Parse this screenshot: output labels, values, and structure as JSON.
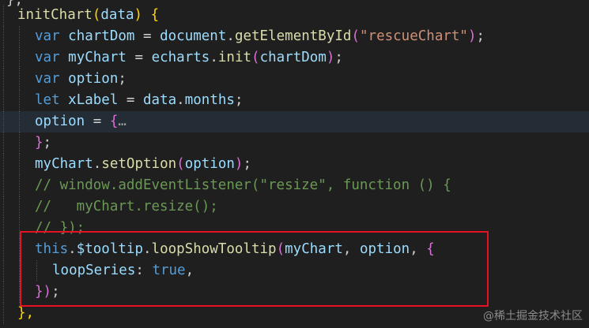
{
  "code": {
    "line0": {
      "text": "};"
    },
    "line1": {
      "name": "initChart",
      "open": "(",
      "param": "data",
      "close": ")",
      "brace": "{"
    },
    "line2": {
      "kw": "var",
      "name": "chartDom",
      "op": "=",
      "obj": "document",
      "method": "getElementById",
      "open": "(",
      "arg": "\"rescueChart\"",
      "close": ")",
      "end": ";"
    },
    "line3": {
      "kw": "var",
      "name": "myChart",
      "op": "=",
      "obj": "echarts",
      "method": "init",
      "open": "(",
      "arg": "chartDom",
      "close": ")",
      "end": ";"
    },
    "line4": {
      "kw": "var",
      "name": "option",
      "end": ";"
    },
    "line5": {
      "kw": "let",
      "name": "xLabel",
      "op": "=",
      "obj": "data",
      "prop": "months",
      "end": ";"
    },
    "line6": {
      "name": "option",
      "op": "=",
      "brace": "{",
      "fold": "…"
    },
    "line7": {
      "brace": "}",
      "end": ";"
    },
    "line8": {
      "obj": "myChart",
      "method": "setOption",
      "open": "(",
      "arg": "option",
      "close": ")",
      "end": ";"
    },
    "line9": {
      "comment": "// window.addEventListener(\"resize\", function () {"
    },
    "line10": {
      "comment": "//   myChart.resize();"
    },
    "line11": {
      "comment": "// });"
    },
    "line12": {
      "kw": "this",
      "prop": "$tooltip",
      "method": "loopShowTooltip",
      "open": "(",
      "arg1": "myChart",
      "arg2": "option",
      "brace": "{"
    },
    "line13": {
      "key": "loopSeries",
      "colon": ":",
      "value": "true",
      "comma": ","
    },
    "line14": {
      "brace": "}",
      "close": ")",
      "end": ";"
    },
    "line15": {
      "text": "},"
    }
  },
  "watermark": "@稀土掘金技术社区",
  "colors": {
    "background": "#1f1f1f",
    "keyword": "#569cd6",
    "function": "#dcdcaa",
    "variable": "#9cdcfe",
    "string": "#ce9178",
    "comment": "#6a9955",
    "highlight_box": "#e81123"
  }
}
